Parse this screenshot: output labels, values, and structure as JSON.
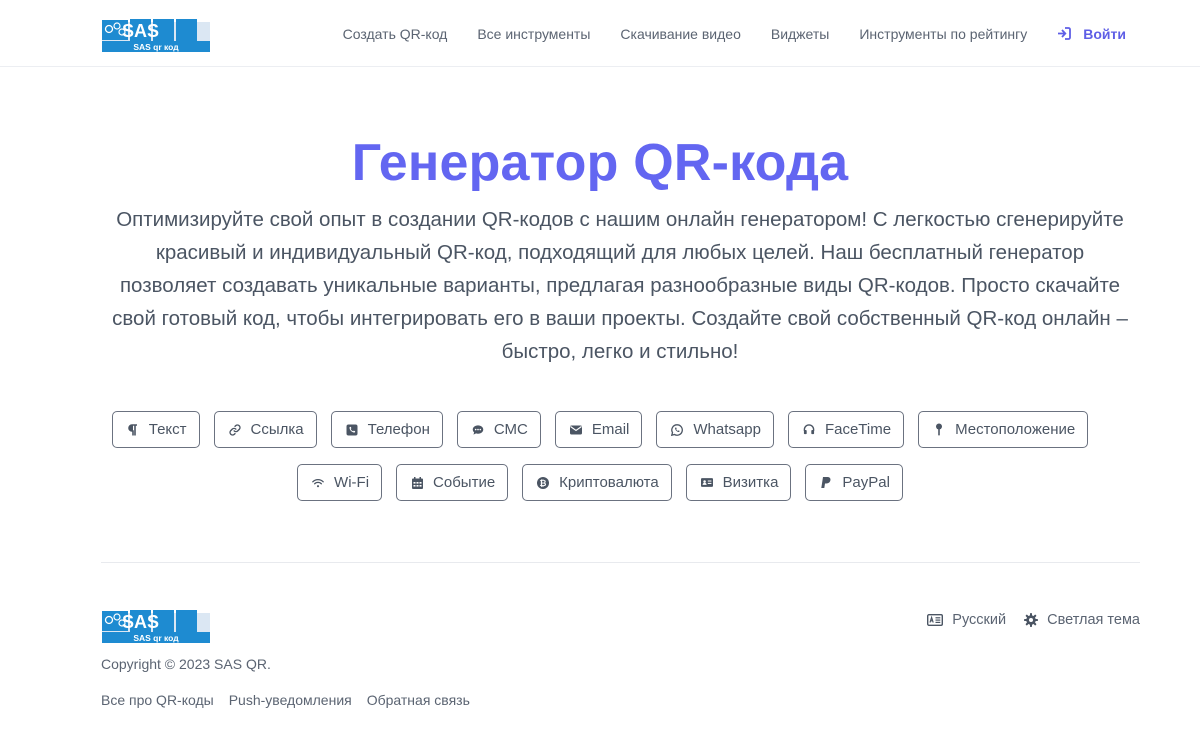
{
  "brand": {
    "logo_text": "SAS",
    "logo_subtext": "SAS qr код",
    "logo_color": "#1e8bd1"
  },
  "nav": {
    "items": [
      {
        "label": "Создать QR-код"
      },
      {
        "label": "Все инструменты"
      },
      {
        "label": "Скачивание видео"
      },
      {
        "label": "Виджеты"
      },
      {
        "label": "Инструменты по рейтингу"
      }
    ],
    "login_label": "Войти",
    "login_icon": "sign-in-icon"
  },
  "hero": {
    "title": "Генератор QR-кода",
    "description": "Оптимизируйте свой опыт в создании QR-кодов с нашим онлайн генератором! С легкостью сгенерируйте красивый и индивидуальный QR-код, подходящий для любых целей. Наш бесплатный генератор позволяет создавать уникальные варианты, предлагая разнообразные виды QR-кодов. Просто скачайте свой готовый код, чтобы интегрировать его в ваши проекты. Создайте свой собственный QR-код онлайн – быстро, легко и стильно!"
  },
  "qr_types": {
    "row1": [
      {
        "label": "Текст",
        "icon": "paragraph-icon"
      },
      {
        "label": "Ссылка",
        "icon": "link-icon"
      },
      {
        "label": "Телефон",
        "icon": "phone-icon"
      },
      {
        "label": "СМС",
        "icon": "sms-icon"
      },
      {
        "label": "Email",
        "icon": "envelope-icon"
      },
      {
        "label": "Whatsapp",
        "icon": "whatsapp-icon"
      },
      {
        "label": "FaceTime",
        "icon": "headset-icon"
      },
      {
        "label": "Местоположение",
        "icon": "map-pin-icon"
      }
    ],
    "row2": [
      {
        "label": "Wi-Fi",
        "icon": "wifi-icon"
      },
      {
        "label": "Событие",
        "icon": "calendar-icon"
      },
      {
        "label": "Криптовалюта",
        "icon": "bitcoin-icon"
      },
      {
        "label": "Визитка",
        "icon": "id-card-icon"
      },
      {
        "label": "PayPal",
        "icon": "paypal-icon"
      }
    ]
  },
  "footer": {
    "copyright": "Copyright © 2023 SAS QR.",
    "links": [
      {
        "label": "Все про QR-коды"
      },
      {
        "label": "Push-уведомления"
      },
      {
        "label": "Обратная связь"
      }
    ],
    "language_label": "Русский",
    "theme_label": "Светлая тема"
  },
  "colors": {
    "accent": "#6366f1",
    "text": "#4b5563",
    "border": "#6b7280"
  }
}
